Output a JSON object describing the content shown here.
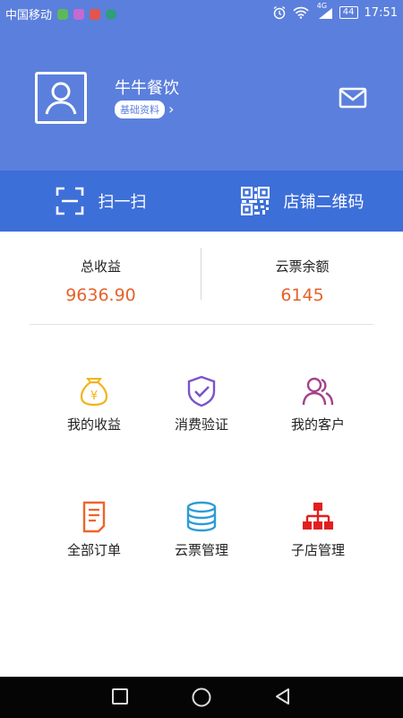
{
  "status_bar": {
    "carrier": "中国移动",
    "network": "4G",
    "battery": "44",
    "time": "17:51",
    "icons": [
      "alarm-icon",
      "wifi-icon",
      "signal-icon",
      "battery-icon"
    ]
  },
  "header": {
    "shop_name": "牛牛餐饮",
    "profile_link": "基础资料",
    "icons": [
      "avatar-icon",
      "mail-icon"
    ]
  },
  "actions": {
    "scan": "扫一扫",
    "qr_code": "店铺二维码"
  },
  "stats": {
    "total_income_label": "总收益",
    "total_income_value": "9636.90",
    "cloud_ticket_balance_label": "云票余额",
    "cloud_ticket_balance_value": "6145"
  },
  "grid": [
    {
      "label": "我的收益",
      "icon": "money-bag-icon"
    },
    {
      "label": "消费验证",
      "icon": "shield-check-icon"
    },
    {
      "label": "我的客户",
      "icon": "users-icon"
    },
    {
      "label": "全部订单",
      "icon": "order-document-icon"
    },
    {
      "label": "云票管理",
      "icon": "database-stack-icon"
    },
    {
      "label": "子店管理",
      "icon": "org-tree-icon"
    }
  ],
  "colors": {
    "header_bg": "#5b7fdc",
    "action_bar_bg": "#3d6fd8",
    "value_orange": "#e6622a",
    "money_yellow": "#f2b418",
    "shield_purple": "#7a55c8",
    "users_magenta": "#a2438a",
    "order_orange": "#f0642a",
    "stack_blue": "#2e9bd6",
    "tree_red": "#e11f1f"
  }
}
